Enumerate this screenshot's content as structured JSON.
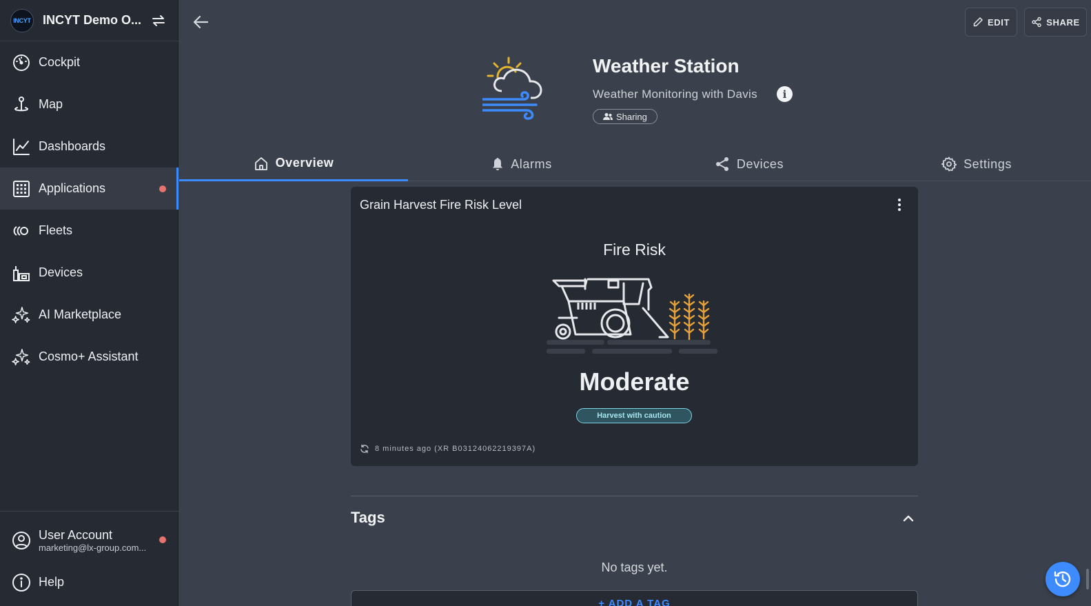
{
  "org": {
    "logo_text": "INCYT",
    "name": "INCYT Demo O..."
  },
  "sidebar": {
    "items": [
      {
        "label": "Cockpit",
        "icon": "gauge-icon"
      },
      {
        "label": "Map",
        "icon": "map-pin-icon"
      },
      {
        "label": "Dashboards",
        "icon": "line-chart-icon"
      },
      {
        "label": "Applications",
        "icon": "grid-icon",
        "active": true,
        "badge": true
      },
      {
        "label": "Fleets",
        "icon": "fleets-icon"
      },
      {
        "label": "Devices",
        "icon": "devices-icon"
      },
      {
        "label": "AI Marketplace",
        "icon": "sparkles-icon"
      },
      {
        "label": "Cosmo+ Assistant",
        "icon": "sparkles-icon"
      }
    ],
    "account": {
      "label": "User Account",
      "email": "marketing@lx-group.com..."
    },
    "help": {
      "label": "Help"
    }
  },
  "header": {
    "edit_label": "EDIT",
    "share_label": "SHARE",
    "title": "Weather Station",
    "subtitle": "Weather Monitoring with Davis",
    "sharing_label": "Sharing"
  },
  "tabs": [
    {
      "label": "Overview",
      "icon": "home-icon",
      "active": true
    },
    {
      "label": "Alarms",
      "icon": "bell-icon"
    },
    {
      "label": "Devices",
      "icon": "share-nodes-icon"
    },
    {
      "label": "Settings",
      "icon": "gear-icon"
    }
  ],
  "widget": {
    "title": "Grain Harvest Fire Risk Level",
    "heading": "Fire Risk",
    "level": "Moderate",
    "advice": "Harvest with caution",
    "updated": "8 minutes ago (XR B03124062219397A)"
  },
  "tags": {
    "title": "Tags",
    "empty": "No tags yet.",
    "add_label": "+ ADD A TAG"
  },
  "colors": {
    "accent": "#3d8bff",
    "badge": "#e8736e",
    "sidebar_bg": "#262a33",
    "main_bg": "#3b414c",
    "pill": "#7fd4e3"
  }
}
